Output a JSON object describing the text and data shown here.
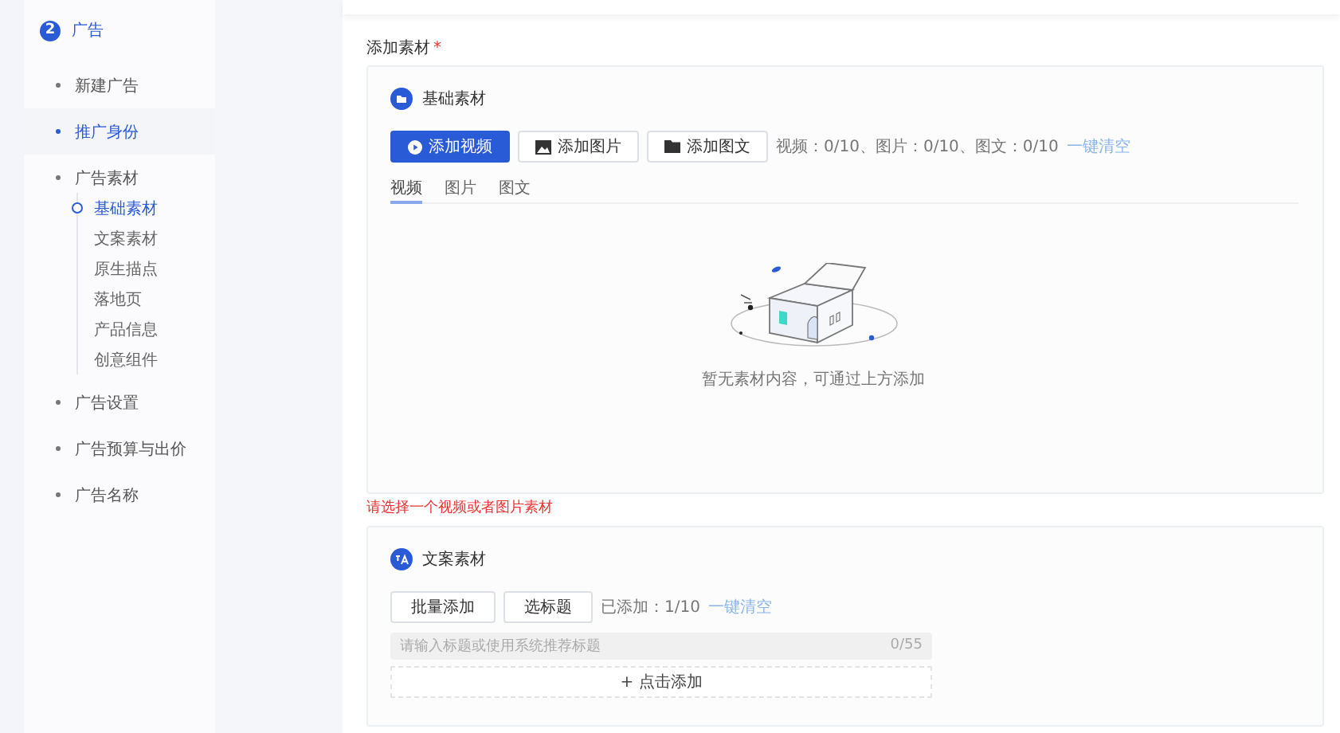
{
  "sidebar": {
    "step": {
      "number": "2",
      "title": "广告"
    },
    "items": [
      {
        "label": "新建广告",
        "selected": false
      },
      {
        "label": "推广身份",
        "selected": true
      },
      {
        "label": "广告素材",
        "selected": false,
        "children": [
          {
            "label": "基础素材",
            "selected": true
          },
          {
            "label": "文案素材",
            "selected": false
          },
          {
            "label": "原生描点",
            "selected": false
          },
          {
            "label": "落地页",
            "selected": false
          },
          {
            "label": "产品信息",
            "selected": false
          },
          {
            "label": "创意组件",
            "selected": false
          }
        ]
      },
      {
        "label": "广告设置",
        "selected": false
      },
      {
        "label": "广告预算与出价",
        "selected": false
      },
      {
        "label": "广告名称",
        "selected": false
      }
    ]
  },
  "section": {
    "label": "添加素材",
    "required_mark": "*"
  },
  "basic_card": {
    "title": "基础素材",
    "buttons": [
      {
        "label": "添加视频",
        "kind": "video",
        "primary": true
      },
      {
        "label": "添加图片",
        "kind": "image",
        "primary": false
      },
      {
        "label": "添加图文",
        "kind": "article",
        "primary": false
      }
    ],
    "counts": "视频：0/10、图片：0/10、图文：0/10",
    "clear_link": "一键清空",
    "tabs": [
      {
        "label": "视频",
        "selected": true
      },
      {
        "label": "图片",
        "selected": false
      },
      {
        "label": "图文",
        "selected": false
      }
    ],
    "empty_text": "暂无素材内容，可通过上方添加"
  },
  "error_text": "请选择一个视频或者图片素材",
  "copy_card": {
    "title": "文案素材",
    "buttons": [
      {
        "label": "批量添加"
      },
      {
        "label": "选标题"
      }
    ],
    "added": "已添加：1/10",
    "clear_link": "一键清空",
    "title_field": {
      "placeholder": "请输入标题或使用系统推荐标题",
      "counter": "0/55"
    },
    "add_button": "+ 点击添加"
  }
}
